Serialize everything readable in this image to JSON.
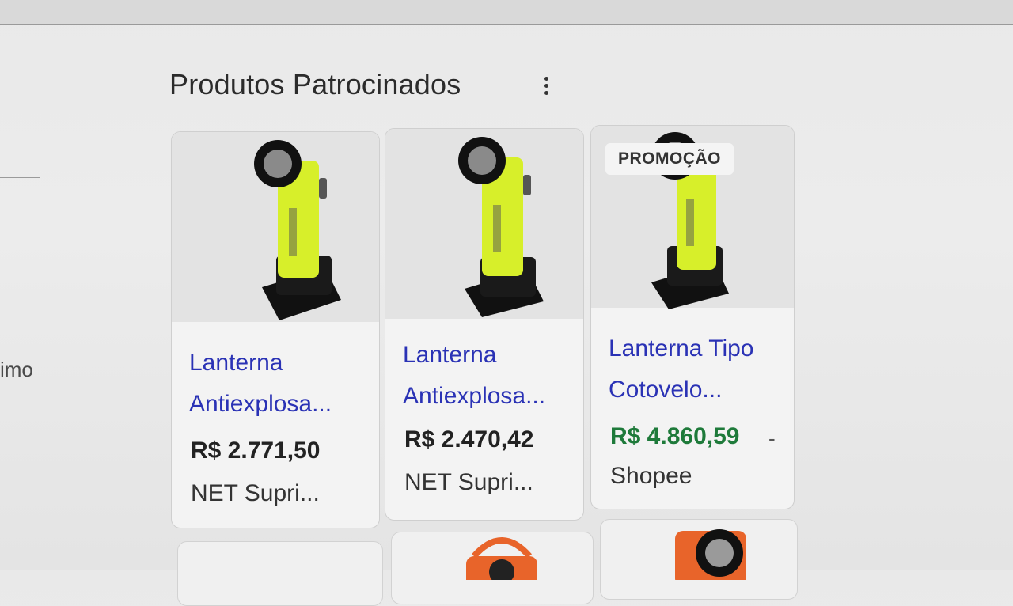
{
  "section": {
    "title": "Produtos Patrocinados",
    "left_partial": "imo"
  },
  "products": [
    {
      "title_line1": "Lanterna",
      "title_line2": "Antiexplosa...",
      "price": "R$ 2.771,50",
      "seller": "NET Supri..."
    },
    {
      "title_line1": "Lanterna",
      "title_line2": "Antiexplosa...",
      "price": "R$ 2.470,42",
      "seller": "NET Supri..."
    },
    {
      "badge": "PROMOÇÃO",
      "title_line1": "Lanterna Tipo",
      "title_line2": "Cotovelo...",
      "price": "R$ 4.860,59",
      "price_suffix": "-",
      "seller": "Shopee",
      "price_color": "#1e7a3a"
    }
  ],
  "colors": {
    "link": "#2a32b5",
    "lamp_yellow": "#d7ef2a",
    "lamp_orange": "#e8642a"
  }
}
